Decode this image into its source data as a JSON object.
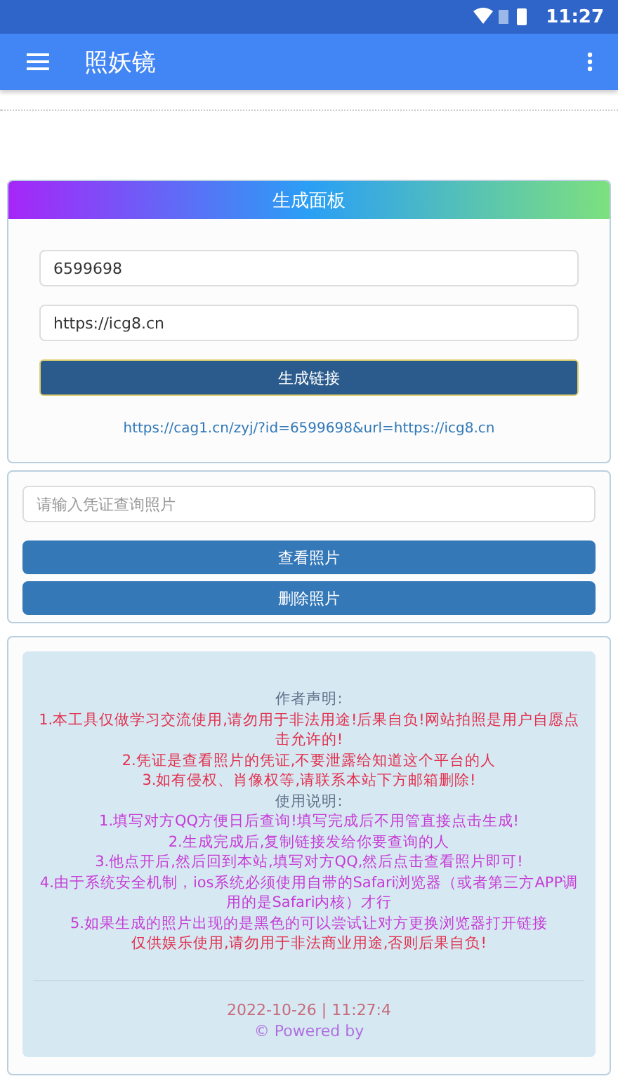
{
  "status_bar": {
    "time": "11:27"
  },
  "app_bar": {
    "title": "照妖镜"
  },
  "generate_panel": {
    "title": "生成面板",
    "id_value": "6599698",
    "url_value": "https://icg8.cn",
    "button": "生成链接",
    "result_link": "https://cag1.cn/zyj/?id=6599698&url=https://icg8.cn"
  },
  "query_panel": {
    "placeholder": "请输入凭证查询照片",
    "buttons": [
      "查看照片",
      "删除照片"
    ]
  },
  "notice": {
    "lines": [
      {
        "kind": "heading",
        "text": "作者声明:"
      },
      {
        "kind": "warning",
        "text": "1.本工具仅做学习交流使用,请勿用于非法用途!后果自负!网站拍照是用户自愿点击允许的!"
      },
      {
        "kind": "warning",
        "text": "2.凭证是查看照片的凭证,不要泄露给知道这个平台的人"
      },
      {
        "kind": "warning",
        "text": "3.如有侵权、肖像权等,请联系本站下方邮箱删除!"
      },
      {
        "kind": "heading",
        "text": "使用说明:"
      },
      {
        "kind": "usage",
        "text": "1.填写对方QQ方便日后查询!填写完成后不用管直接点击生成!"
      },
      {
        "kind": "usage",
        "text": "2.生成完成后,复制链接发给你要查询的人"
      },
      {
        "kind": "usage",
        "text": "3.他点开后,然后回到本站,填写对方QQ,然后点击查看照片即可!"
      },
      {
        "kind": "usage",
        "text": "4.由于系统安全机制，ios系统必须使用自带的Safari浏览器（或者第三方APP调用的是Safari内核）才行"
      },
      {
        "kind": "usage",
        "text": "5.如果生成的照片出现的是黑色的可以尝试让对方更换浏览器打开链接"
      },
      {
        "kind": "warning",
        "text": "仅供娱乐使用,请勿用于非法商业用途,否则后果自负!"
      }
    ],
    "footer_date": "2022-10-26 | 11:27:4",
    "footer_powered": "© Powered by"
  }
}
